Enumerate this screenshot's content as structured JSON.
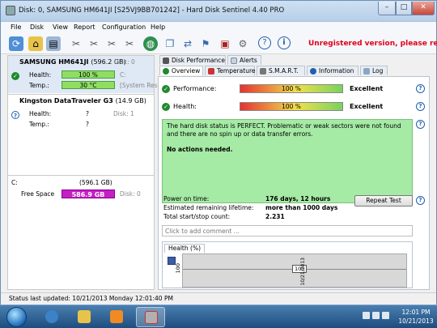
{
  "window": {
    "title": "Disk: 0, SAMSUNG HM641JI [S25VJ9BB701242] - Hard Disk Sentinel 4.40 PRO",
    "minimize": "–",
    "maximize": "□",
    "close": "✕"
  },
  "menu": [
    "File",
    "Disk",
    "View",
    "Report",
    "Configuration",
    "Help"
  ],
  "toolbar": {
    "icons": [
      "refresh-icon",
      "home-icon",
      "disk-list-icon",
      "tools-icon",
      "tools-2-icon",
      "tools-3-icon",
      "tools-4-icon",
      "globe-icon",
      "disk-copy-icon",
      "sync-icon",
      "flag-icon",
      "test-icon",
      "settings-icon",
      "help-icon",
      "info-icon"
    ],
    "unregistered": "Unregistered version, please registe"
  },
  "disks": [
    {
      "title": "SAMSUNG HM641JI",
      "size": "(596.2 GB)",
      "index": "Disk: 0",
      "health_label": "Health:",
      "health_value": "100 %",
      "health_note": "C:",
      "temp_label": "Temp.:",
      "temp_value": "30 °C",
      "temp_note": "[System Rese"
    },
    {
      "title": "Kingston DataTraveler G3",
      "size": "(14.9 GB)",
      "index": "Disk: 1",
      "health_label": "Health:",
      "health_value": "?",
      "temp_label": "Temp.:",
      "temp_value": "?"
    }
  ],
  "volume": {
    "letter": "C:",
    "size": "(596.1 GB)",
    "free_label": "Free Space",
    "free_value": "586.9 GB",
    "disk_ref": "Disk: 0"
  },
  "tabs_top": [
    "Disk Performance",
    "Alerts"
  ],
  "tabs_main": [
    "Overview",
    "Temperature",
    "S.M.A.R.T.",
    "Information",
    "Log"
  ],
  "overview": {
    "performance_label": "Performance:",
    "performance_value": "100 %",
    "performance_rating": "Excellent",
    "health_label": "Health:",
    "health_value": "100 %",
    "health_rating": "Excellent",
    "status_text": "The hard disk status is PERFECT. Problematic or weak sectors were not found and there are no spin up or data transfer errors.",
    "actions_text": "No actions needed.",
    "power_on_label": "Power on time:",
    "power_on_value": "176 days, 12 hours",
    "lifetime_label": "Estimated remaining lifetime:",
    "lifetime_value": "more than 1000 days",
    "startstop_label": "Total start/stop count:",
    "startstop_value": "2.231",
    "repeat_test": "Repeat Test",
    "comment_placeholder": "Click to add comment ...",
    "health_tab": "Health (%)",
    "graph_y": "100",
    "graph_point": "100",
    "graph_date": "10/21/2013"
  },
  "statusbar": "Status last updated: 10/21/2013 Monday 12:01:40 PM",
  "clock": {
    "time": "12:01 PM",
    "date": "10/21/2013"
  }
}
